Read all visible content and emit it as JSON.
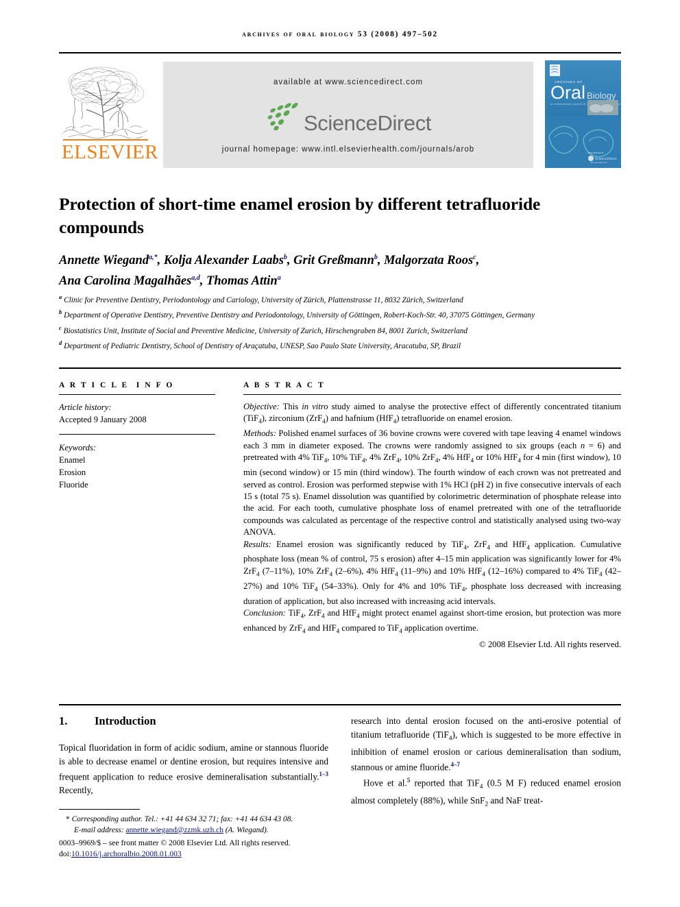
{
  "running_head": "Archives of Oral Biology 53 (2008) 497–502",
  "banner": {
    "publisher_name": "ELSEVIER",
    "available_at": "available at www.sciencedirect.com",
    "sciencedirect_wordmark": "ScienceDirect",
    "journal_homepage": "journal homepage: www.intl.elsevierhealth.com/journals/arob",
    "cover": {
      "line1": "ARCHIVES OF",
      "line2": "Oral",
      "line3": "Biology",
      "subtitle": "an international journal of oral biology and medicine"
    },
    "colors": {
      "elsevier_orange": "#F07F1A",
      "sciencedirect_green": "#5aa84f",
      "sciencedirect_gray": "#6d6e70",
      "panel_gray": "#e3e3e3",
      "cover_blue": "#2f7fb5"
    }
  },
  "article": {
    "title": "Protection of short-time enamel erosion by different tetrafluoride compounds",
    "authors": [
      {
        "name": "Annette Wiegand",
        "marks": "a,*"
      },
      {
        "name": "Kolja Alexander Laabs",
        "marks": "b"
      },
      {
        "name": "Grit Greßmann",
        "marks": "b"
      },
      {
        "name": "Malgorzata Roos",
        "marks": "c"
      },
      {
        "name": "Ana Carolina Magalhães",
        "marks": "a,d"
      },
      {
        "name": "Thomas Attin",
        "marks": "a"
      }
    ],
    "affiliations": [
      {
        "mark": "a",
        "text": "Clinic for Preventive Dentistry, Periodontology and Cariology, University of Zürich, Plattenstrasse 11, 8032 Zürich, Switzerland"
      },
      {
        "mark": "b",
        "text": "Department of Operative Dentistry, Preventive Dentistry and Periodontology, University of Göttingen, Robert-Koch-Str. 40, 37075 Göttingen, Germany"
      },
      {
        "mark": "c",
        "text": "Biostatistics Unit, Institute of Social and Preventive Medicine, University of Zurich, Hirschengraben 84, 8001 Zurich, Switzerland"
      },
      {
        "mark": "d",
        "text": "Department of Pediatric Dentistry, School of Dentistry of Araçatuba, UNESP, Sao Paulo State University, Aracatuba, SP, Brazil"
      }
    ]
  },
  "article_info": {
    "heading": "ARTICLE INFO",
    "history_label": "Article history:",
    "history_value": "Accepted 9 January 2008",
    "keywords_label": "Keywords:",
    "keywords": [
      "Enamel",
      "Erosion",
      "Fluoride"
    ]
  },
  "abstract": {
    "heading": "ABSTRACT",
    "objective_label": "Objective:",
    "objective_text": " This in vitro study aimed to analyse the protective effect of differently concentrated titanium (TiF4), zirconium (ZrF4) and hafnium (HfF4) tetrafluoride on enamel erosion.",
    "methods_label": "Methods:",
    "methods_text": " Polished enamel surfaces of 36 bovine crowns were covered with tape leaving 4 enamel windows each 3 mm in diameter exposed. The crowns were randomly assigned to six groups (each n = 6) and pretreated with 4% TiF4, 10% TiF4, 4% ZrF4, 10% ZrF4, 4% HfF4 or 10% HfF4 for 4 min (first window), 10 min (second window) or 15 min (third window). The fourth window of each crown was not pretreated and served as control. Erosion was performed stepwise with 1% HCl (pH 2) in five consecutive intervals of each 15 s (total 75 s). Enamel dissolution was quantified by colorimetric determination of phosphate release into the acid. For each tooth, cumulative phosphate loss of enamel pretreated with one of the tetrafluoride compounds was calculated as percentage of the respective control and statistically analysed using two-way ANOVA.",
    "results_label": "Results:",
    "results_text": " Enamel erosion was significantly reduced by TiF4, ZrF4 and HfF4 application. Cumulative phosphate loss (mean % of control, 75 s erosion) after 4–15 min application was significantly lower for 4% ZrF4 (7–11%), 10% ZrF4 (2–6%), 4% HfF4 (11–9%) and 10% HfF4 (12–16%) compared to 4% TiF4 (42–27%) and 10% TiF4 (54–33%). Only for 4% and 10% TiF4, phosphate loss decreased with increasing duration of application, but also increased with increasing acid intervals.",
    "conclusion_label": "Conclusion:",
    "conclusion_text": " TiF4, ZrF4 and HfF4 might protect enamel against short-time erosion, but protection was more enhanced by ZrF4 and HfF4 compared to TiF4 application overtime.",
    "copyright": "© 2008 Elsevier Ltd. All rights reserved."
  },
  "introduction": {
    "number": "1.",
    "heading": "Introduction",
    "left_paragraph": "Topical fluoridation in form of acidic sodium, amine or stannous fluoride is able to decrease enamel or dentine erosion, but requires intensive and frequent application to reduce erosive demineralisation substantially.",
    "left_ref": "1–3",
    "left_tail": " Recently,",
    "right_paragraph": "research into dental erosion focused on the anti-erosive potential of titanium tetrafluoride (TiF4), which is suggested to be more effective in inhibition of enamel erosion or carious demineralisation than sodium, stannous or amine fluoride.",
    "right_ref": "4–7",
    "right_paragraph2_pre": "Hove et al.",
    "right_ref2": "5",
    "right_paragraph2_post": " reported that TiF4 (0.5 M F) reduced enamel erosion almost completely (88%), while SnF2 and NaF treat-"
  },
  "footnote": {
    "corresponding": "Corresponding author. Tel.: +41 44 634 32 71; fax: +41 44 634 43 08.",
    "email_label": "E-mail address:",
    "email": "annette.wiegand@zzmk.uzh.ch",
    "email_suffix": " (A. Wiegand).",
    "front_matter": "0003–9969/$ – see front matter © 2008 Elsevier Ltd. All rights reserved.",
    "doi_label": "doi:",
    "doi": "10.1016/j.archoralbio.2008.01.003"
  }
}
